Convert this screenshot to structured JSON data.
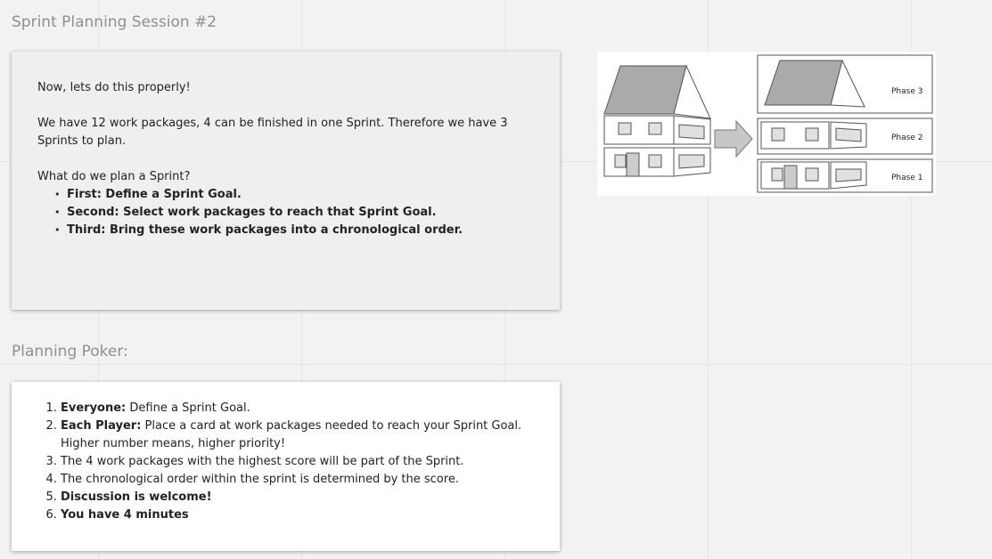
{
  "frame1": {
    "title": "Sprint Planning Session #2",
    "intro": "Now, lets do this properly!",
    "paragraph": "We have 12 work packages, 4 can be finished in one Sprint. Therefore we have 3 Sprints to plan.",
    "question": "What do we plan a Sprint?",
    "bullets": [
      "First: Define a Sprint Goal.",
      "Second: Select work packages to reach that Sprint Goal.",
      "Third: Bring these work packages into a chronological order."
    ]
  },
  "diagram": {
    "icon": "house-phases-diagram",
    "phases": [
      "Phase 3",
      "Phase 2",
      "Phase 1"
    ]
  },
  "frame2": {
    "title": "Planning Poker:",
    "steps": [
      {
        "bold": "Everyone:",
        "text": " Define a Sprint Goal."
      },
      {
        "bold": "Each Player:",
        "text": " Place a card at work packages needed to reach your Sprint Goal. Higher number means, higher priority!"
      },
      {
        "bold": "",
        "text": "The 4 work packages with the highest score will be part of the Sprint."
      },
      {
        "bold": "",
        "text": "The chronological order within the sprint is determined by the score."
      },
      {
        "bold": "Discussion is welcome!",
        "text": ""
      },
      {
        "bold": "You have 4 minutes",
        "text": ""
      }
    ]
  }
}
